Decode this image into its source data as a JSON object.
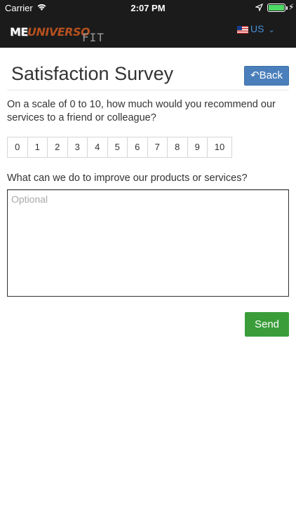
{
  "status_bar": {
    "carrier": "Carrier",
    "time": "2:07 PM"
  },
  "header": {
    "logo_me": "ME",
    "logo_universo": "UNIVERSO",
    "logo_fit": "FIT",
    "language": "US",
    "battery_color": "#4cd964",
    "bar_color": "#1b1b1b"
  },
  "survey": {
    "title": "Satisfaction Survey",
    "back_label": "Back",
    "question": "On a scale of 0 to 10, how much would you recommend our services to a friend or colleague?",
    "scale_options": [
      "0",
      "1",
      "2",
      "3",
      "4",
      "5",
      "6",
      "7",
      "8",
      "9",
      "10"
    ],
    "improve_question": "What can we do to improve our products or services?",
    "feedback_placeholder": "Optional",
    "feedback_value": "",
    "send_label": "Send",
    "back_color": "#4a7fbb",
    "send_color": "#3a9d3a"
  }
}
